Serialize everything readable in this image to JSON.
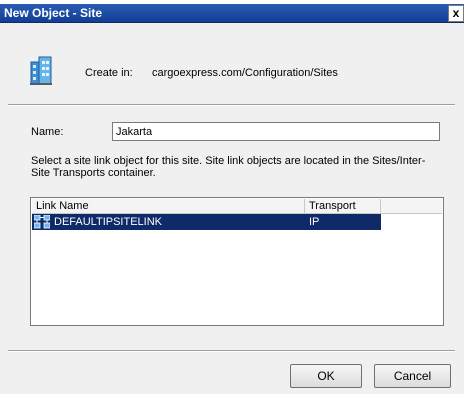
{
  "window": {
    "title": "New Object - Site",
    "close_glyph": "x"
  },
  "create_in": {
    "label": "Create in:",
    "path": "cargoexpress.com/Configuration/Sites"
  },
  "name_field": {
    "label": "Name:",
    "value": "Jakarta"
  },
  "description": "Select a site link object for this site. Site link objects are located in the Sites/Inter-Site Transports container.",
  "link_list": {
    "columns": [
      "Link Name",
      "Transport"
    ],
    "rows": [
      {
        "name": "DEFAULTIPSITELINK",
        "transport": "IP",
        "selected": true
      }
    ]
  },
  "buttons": {
    "ok": "OK",
    "cancel": "Cancel"
  },
  "icons": {
    "site": "site-object-icon",
    "row": "site-link-icon"
  },
  "colors": {
    "titlebar": "#1d4ea5",
    "selection": "#0e2a68"
  }
}
